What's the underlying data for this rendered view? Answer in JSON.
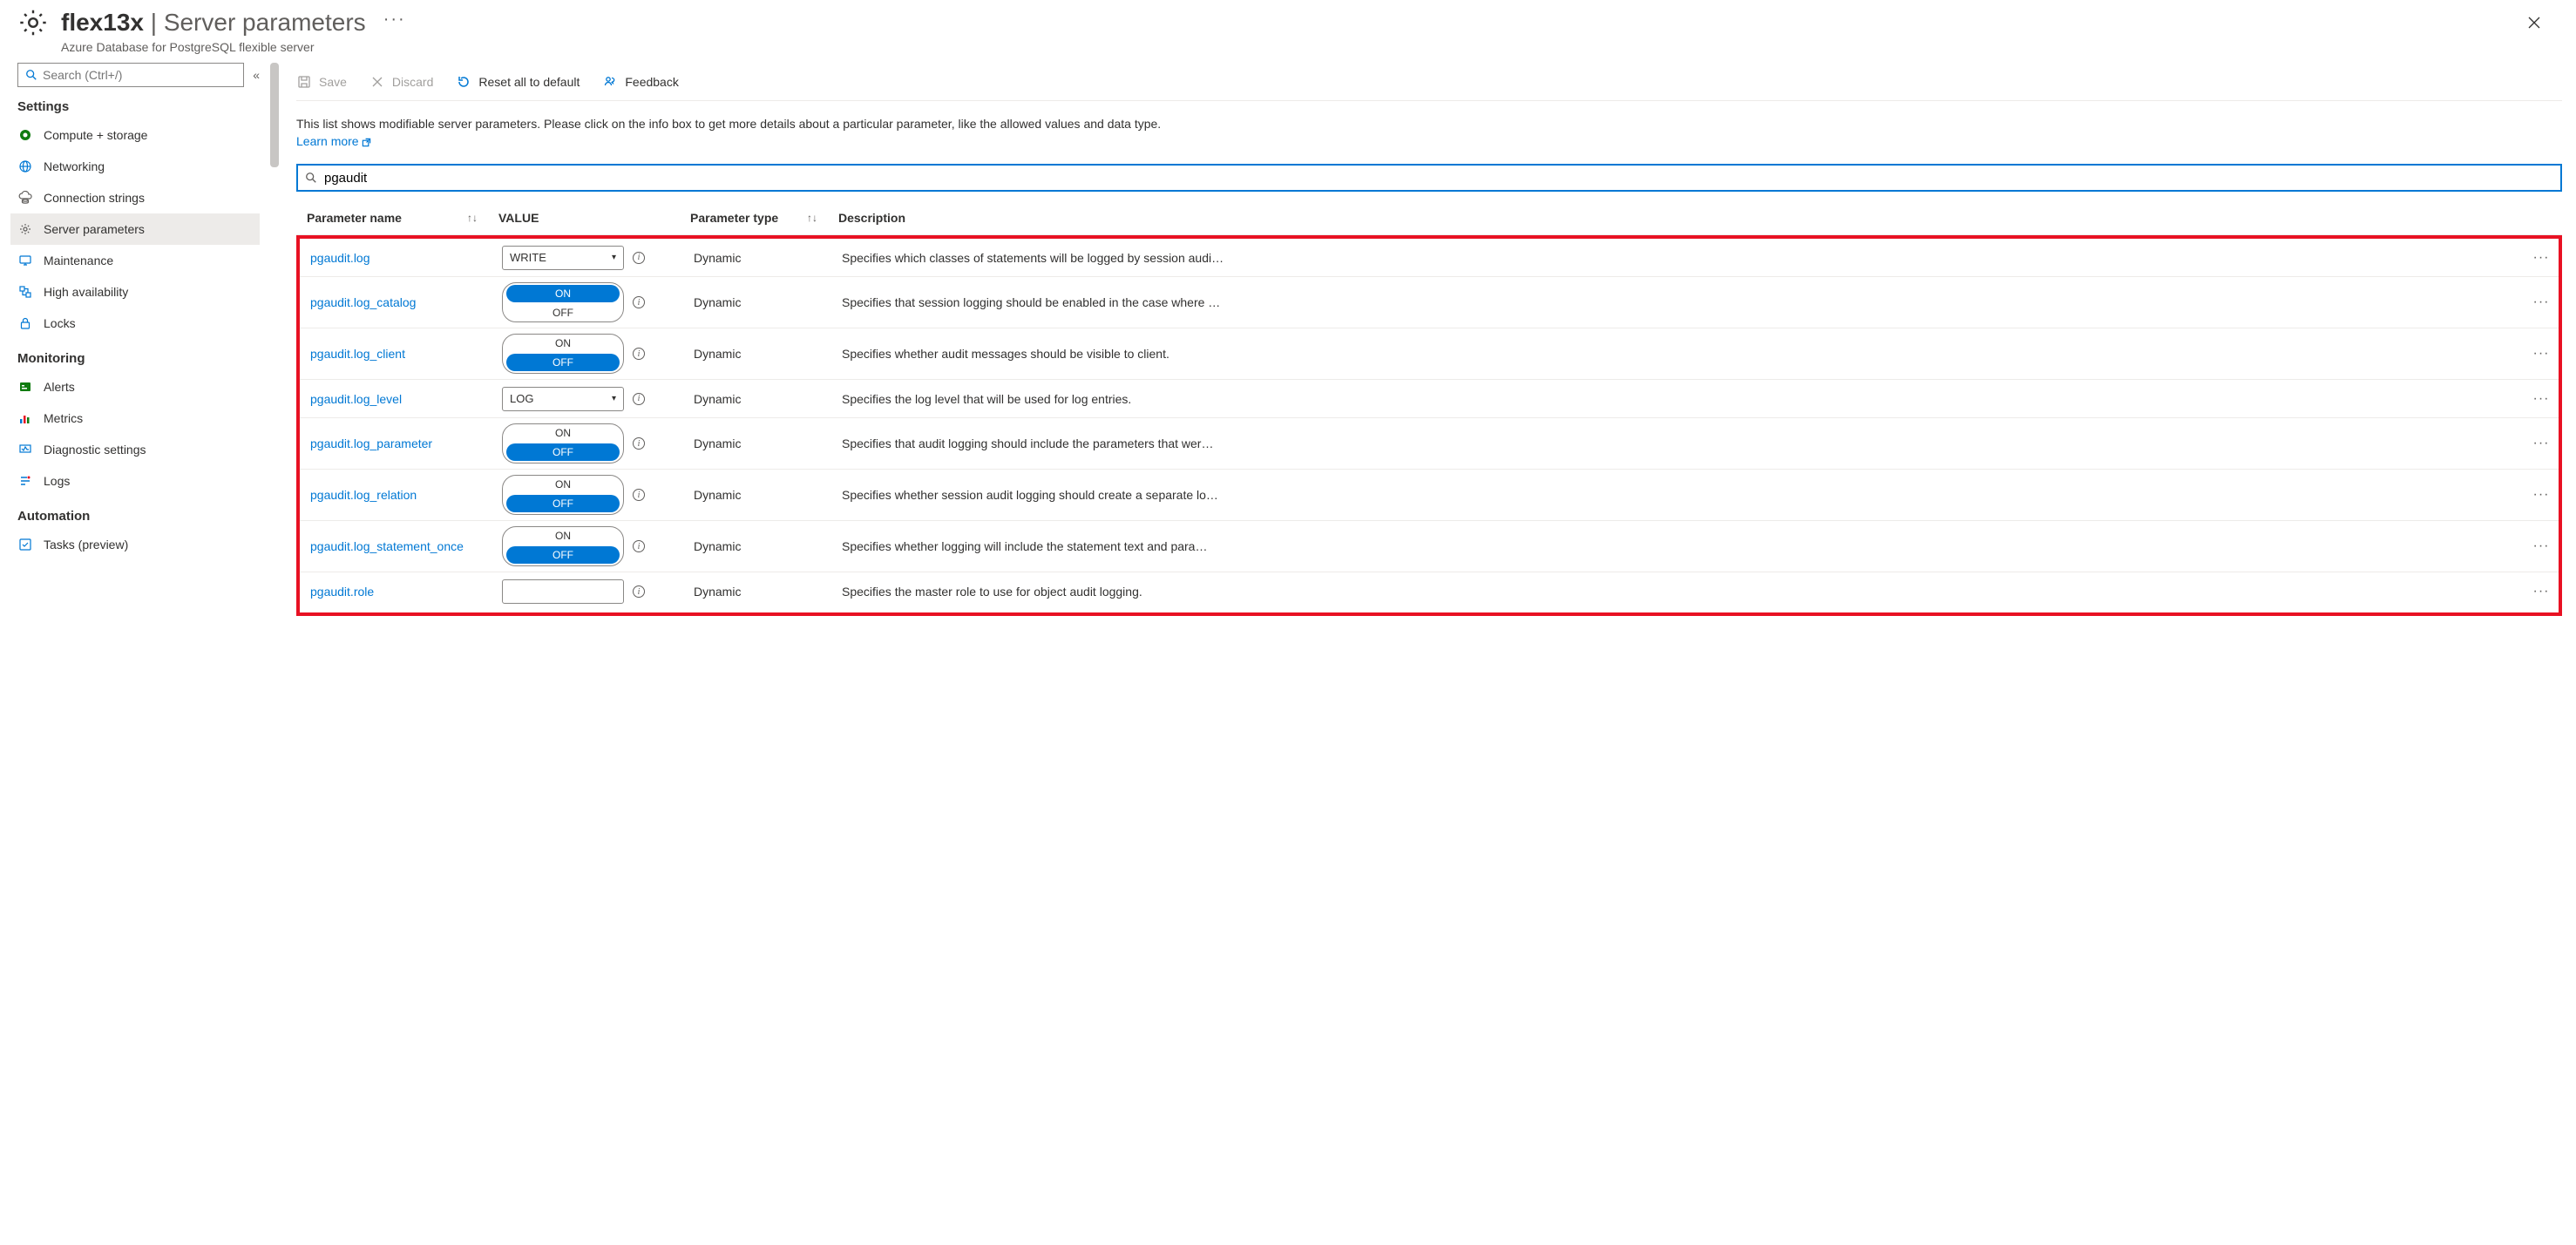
{
  "header": {
    "title_server": "flex13x",
    "title_page": "Server parameters",
    "subtitle": "Azure Database for PostgreSQL flexible server",
    "more_glyph": "···"
  },
  "sidebar": {
    "search_placeholder": "Search (Ctrl+/)",
    "collapse_glyph": "«",
    "sections": [
      {
        "heading": "Settings",
        "items": [
          {
            "label": "Compute + storage",
            "icon": "compute-icon",
            "color": "#107c10"
          },
          {
            "label": "Networking",
            "icon": "globe-icon",
            "color": "#0078d4"
          },
          {
            "label": "Connection strings",
            "icon": "cloud-db-icon",
            "color": "#605e5c"
          },
          {
            "label": "Server parameters",
            "icon": "gear-icon",
            "color": "#605e5c",
            "active": true
          },
          {
            "label": "Maintenance",
            "icon": "monitor-icon",
            "color": "#0078d4"
          },
          {
            "label": "High availability",
            "icon": "ha-icon",
            "color": "#0078d4"
          },
          {
            "label": "Locks",
            "icon": "lock-icon",
            "color": "#0078d4"
          }
        ]
      },
      {
        "heading": "Monitoring",
        "items": [
          {
            "label": "Alerts",
            "icon": "alerts-icon",
            "color": "#107c10"
          },
          {
            "label": "Metrics",
            "icon": "metrics-icon",
            "color": "#0078d4"
          },
          {
            "label": "Diagnostic settings",
            "icon": "diag-icon",
            "color": "#0078d4"
          },
          {
            "label": "Logs",
            "icon": "logs-icon",
            "color": "#0078d4"
          }
        ]
      },
      {
        "heading": "Automation",
        "items": [
          {
            "label": "Tasks (preview)",
            "icon": "tasks-icon",
            "color": "#0078d4"
          }
        ]
      }
    ]
  },
  "toolbar": {
    "save": "Save",
    "discard": "Discard",
    "reset": "Reset all to default",
    "feedback": "Feedback"
  },
  "info": {
    "text": "This list shows modifiable server parameters. Please click on the info box to get more details about a particular parameter, like the allowed values and data type.",
    "learn_more": "Learn more"
  },
  "param_search": {
    "value": "pgaudit"
  },
  "table": {
    "headers": {
      "name": "Parameter name",
      "value": "VALUE",
      "type": "Parameter type",
      "desc": "Description"
    },
    "rows": [
      {
        "name": "pgaudit.log",
        "value_kind": "select",
        "value": "WRITE",
        "type": "Dynamic",
        "desc": "Specifies which classes of statements will be logged by session audi…"
      },
      {
        "name": "pgaudit.log_catalog",
        "value_kind": "toggle",
        "value": "ON",
        "type": "Dynamic",
        "desc": "Specifies that session logging should be enabled in the case where …"
      },
      {
        "name": "pgaudit.log_client",
        "value_kind": "toggle",
        "value": "OFF",
        "type": "Dynamic",
        "desc": "Specifies whether audit messages should be visible to client."
      },
      {
        "name": "pgaudit.log_level",
        "value_kind": "select",
        "value": "LOG",
        "type": "Dynamic",
        "desc": "Specifies the log level that will be used for log entries."
      },
      {
        "name": "pgaudit.log_parameter",
        "value_kind": "toggle",
        "value": "OFF",
        "type": "Dynamic",
        "desc": "Specifies that audit logging should include the parameters that wer…"
      },
      {
        "name": "pgaudit.log_relation",
        "value_kind": "toggle",
        "value": "OFF",
        "type": "Dynamic",
        "desc": "Specifies whether session audit logging should create a separate lo…"
      },
      {
        "name": "pgaudit.log_statement_once",
        "value_kind": "toggle",
        "value": "OFF",
        "type": "Dynamic",
        "desc": "Specifies whether logging will include the statement text and para…"
      },
      {
        "name": "pgaudit.role",
        "value_kind": "input",
        "value": "",
        "type": "Dynamic",
        "desc": "Specifies the master role to use for object audit logging."
      }
    ],
    "toggle_on": "ON",
    "toggle_off": "OFF",
    "row_more": "···"
  }
}
